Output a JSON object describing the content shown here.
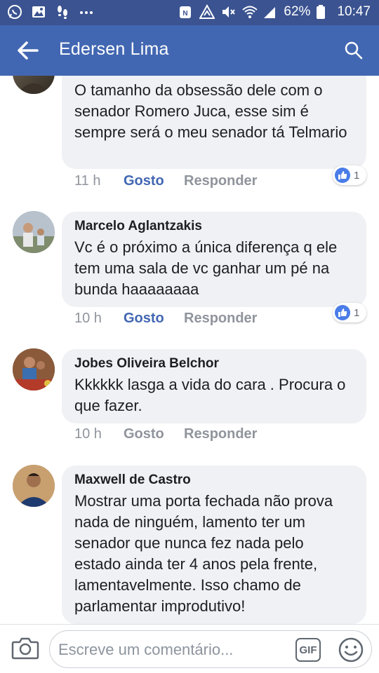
{
  "status_bar": {
    "battery": "62%",
    "time": "10:47",
    "left_icons": [
      "whatsapp-icon",
      "gallery-icon",
      "footsteps-icon",
      "more-icon"
    ],
    "right_icons": [
      "nfc-icon",
      "data-saver-icon",
      "mute-icon",
      "wifi-icon",
      "signal-icon",
      "battery-icon"
    ]
  },
  "app_bar": {
    "title": "Edersen Lima",
    "back_icon": "arrow-left-icon",
    "search_icon": "search-icon",
    "color": "#4267b2"
  },
  "comments": [
    {
      "author": "",
      "text": "O tamanho da obsessão dele com o senador Romero Juca, esse sim é sempre será o meu senador tá Telmario",
      "time": "11 h",
      "like_label": "Gosto",
      "liked": true,
      "reply_label": "Responder",
      "reactions": "1"
    },
    {
      "author": "Marcelo Aglantzakis",
      "text": "Vc é o próximo a única diferença q ele tem uma sala de vc ganhar um pé na bunda haaaaaaaa",
      "time": "10 h",
      "like_label": "Gosto",
      "liked": true,
      "reply_label": "Responder",
      "reactions": "1"
    },
    {
      "author": "Jobes Oliveira Belchor",
      "text": "Kkkkkk lasga a vida do cara . Procura o que fazer.",
      "time": "10 h",
      "like_label": "Gosto",
      "liked": false,
      "reply_label": "Responder",
      "reactions": ""
    },
    {
      "author": "Maxwell de Castro",
      "text": "Mostrar uma porta fechada não prova nada de ninguém, lamento ter um senador que nunca fez nada pelo estado ainda ter 4 anos pela frente, lamentavelmente. Isso chamo de parlamentar improdutivo!",
      "time": "",
      "like_label": "",
      "liked": false,
      "reply_label": "",
      "reactions": ""
    }
  ],
  "composer": {
    "placeholder": "Escreve um comentário...",
    "gif_label": "GIF",
    "camera_icon": "camera-icon",
    "emoji_icon": "emoji-icon"
  }
}
